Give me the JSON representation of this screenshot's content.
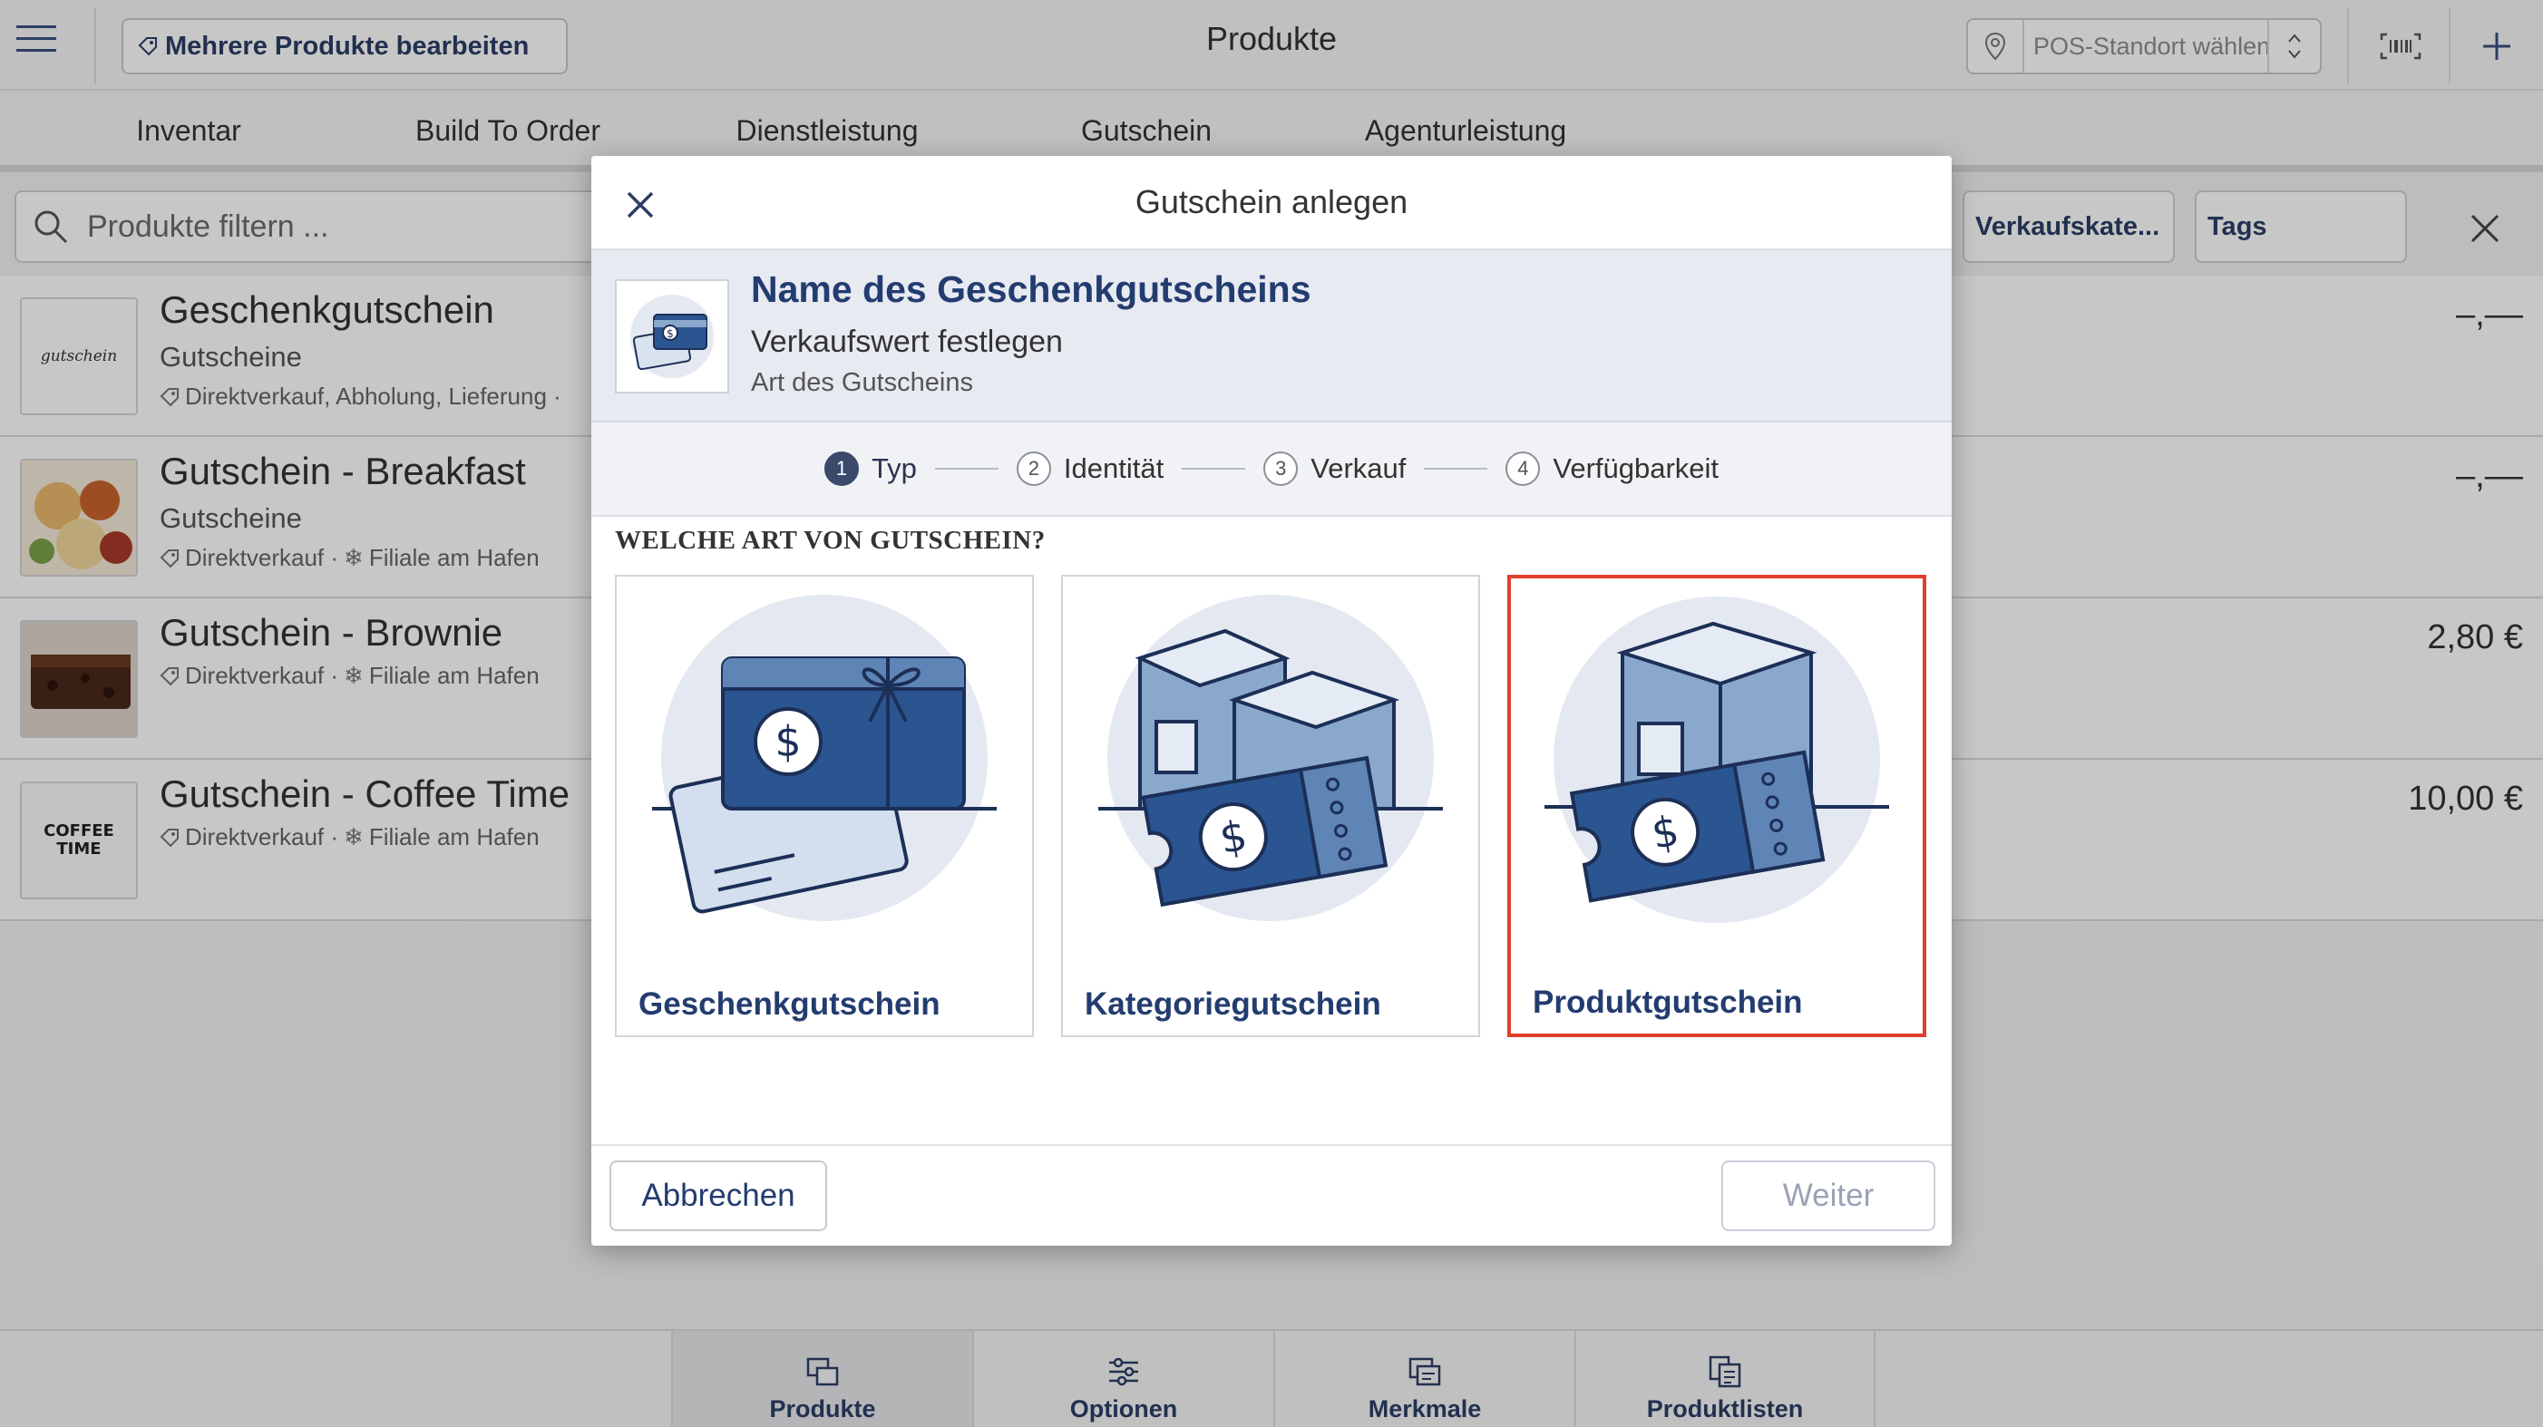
{
  "app": {
    "title": "Produkte",
    "multi_edit_label": "Mehrere Produkte bearbeiten",
    "pos_placeholder": "POS-Standort wählen...",
    "icons": {
      "menu": "hamburger-icon",
      "pos": "location-pin-icon",
      "barcode": "barcode-icon",
      "add": "plus-icon"
    }
  },
  "tabs": [
    "Inventar",
    "Build To Order",
    "Dienstleistung",
    "Gutschein",
    "Agenturleistung"
  ],
  "filter": {
    "search_placeholder": "Produkte filtern ...",
    "chips": [
      "Verkaufskate...",
      "Tags"
    ]
  },
  "products": [
    {
      "name": "Geschenkgutschein",
      "category": "Gutscheine",
      "meta": "Direktverkauf, Abholung, Lieferung · ",
      "price": "–,––",
      "thumb_text": "gutschein"
    },
    {
      "name": "Gutschein - Breakfast",
      "category": "Gutscheine",
      "meta": "Direktverkauf · ",
      "location": "Filiale am Hafen",
      "price": "–,––"
    },
    {
      "name": "Gutschein - Brownie",
      "category": "",
      "meta": "Direktverkauf · ",
      "location": "Filiale am Hafen",
      "price": "2,80 €"
    },
    {
      "name": "Gutschein - Coffee Time",
      "category": "",
      "meta": "Direktverkauf · ",
      "location": "Filiale am Hafen",
      "price": "10,00 €",
      "thumb_text": "COFFEE TIME"
    }
  ],
  "bottom_nav": [
    "Produkte",
    "Optionen",
    "Merkmale",
    "Produktlisten"
  ],
  "modal": {
    "title": "Gutschein anlegen",
    "summary": {
      "title": "Name des Geschenkgutscheins",
      "subtitle": "Verkaufswert festlegen",
      "type": "Art des Gutscheins"
    },
    "steps": [
      {
        "num": "1",
        "label": "Typ"
      },
      {
        "num": "2",
        "label": "Identität"
      },
      {
        "num": "3",
        "label": "Verkauf"
      },
      {
        "num": "4",
        "label": "Verfügbarkeit"
      }
    ],
    "active_step": 1,
    "question": "WELCHE ART VON GUTSCHEIN?",
    "options": [
      "Geschenkgutschein",
      "Kategoriegutschein",
      "Produktgutschein"
    ],
    "selected_option": "Produktgutschein",
    "cancel_label": "Abbrechen",
    "next_label": "Weiter"
  },
  "colors": {
    "accent": "#233c70",
    "selected_border": "#e0402c",
    "illustration_dark": "#2b5590",
    "illustration_light": "#8aa8cc",
    "illustration_circle": "#e4e9f1"
  }
}
